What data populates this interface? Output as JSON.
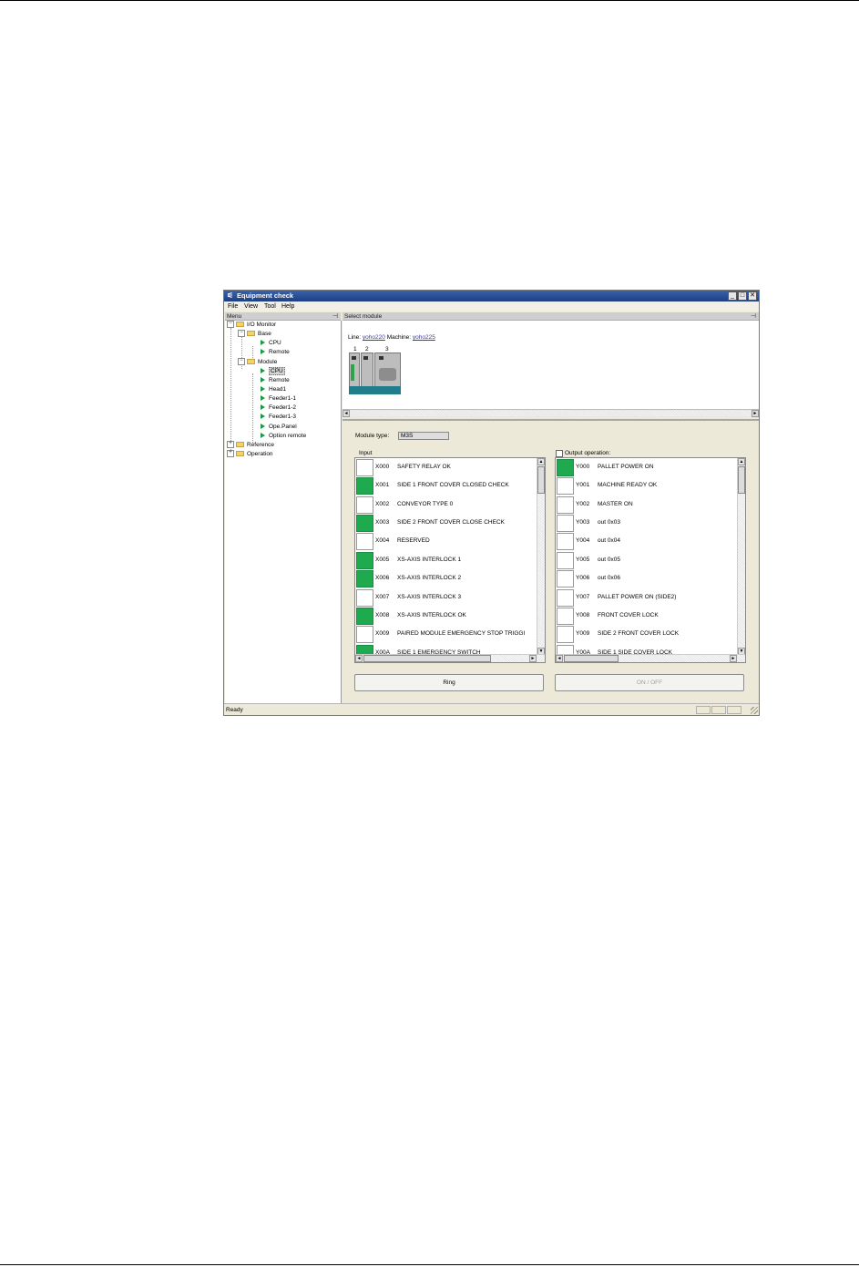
{
  "window": {
    "title": "Equipment check",
    "controls": [
      "_",
      "□",
      "✕"
    ]
  },
  "menubar": [
    "File",
    "View",
    "Tool",
    "Help"
  ],
  "left_pane": {
    "header": "Menu",
    "pin": "⊣",
    "tree": [
      {
        "label": "I/O Monitor",
        "kind": "folder"
      },
      {
        "label": "Base",
        "kind": "folder"
      },
      {
        "label": "CPU",
        "kind": "leaf"
      },
      {
        "label": "Remote",
        "kind": "leaf"
      },
      {
        "label": "Module",
        "kind": "folder"
      },
      {
        "label": "CPU",
        "kind": "leaf",
        "selected": true
      },
      {
        "label": "Remote",
        "kind": "leaf"
      },
      {
        "label": "Head1",
        "kind": "leaf"
      },
      {
        "label": "Feeder1-1",
        "kind": "leaf"
      },
      {
        "label": "Feeder1-2",
        "kind": "leaf"
      },
      {
        "label": "Feeder1-3",
        "kind": "leaf"
      },
      {
        "label": "Ope.Panel",
        "kind": "leaf"
      },
      {
        "label": "Option remote",
        "kind": "leaf"
      },
      {
        "label": "Reference",
        "kind": "folder"
      },
      {
        "label": "Operation",
        "kind": "folder"
      }
    ]
  },
  "select_module": {
    "header": "Select module",
    "pin": "⊣",
    "line_label": "Line:",
    "line_value": "yoho220",
    "machine_label": "Machine:",
    "machine_value": "yoho225",
    "slots": [
      "1",
      "2",
      "3"
    ],
    "scroll_left": "◄",
    "scroll_right": "►"
  },
  "io": {
    "module_type_label": "Module type:",
    "module_type_value": "M3S",
    "input_label": "Input",
    "output_label": "Output operation:",
    "inputs": [
      {
        "addr": "X000",
        "name": "SAFETY RELAY OK",
        "on": false
      },
      {
        "addr": "X001",
        "name": "SIDE 1 FRONT COVER CLOSED CHECK",
        "on": true
      },
      {
        "addr": "X002",
        "name": "CONVEYOR TYPE 0",
        "on": false
      },
      {
        "addr": "X003",
        "name": "SIDE 2 FRONT COVER CLOSE CHECK",
        "on": true
      },
      {
        "addr": "X004",
        "name": "RESERVED",
        "on": false
      },
      {
        "addr": "X005",
        "name": "XS-AXIS INTERLOCK 1",
        "on": true
      },
      {
        "addr": "X006",
        "name": "XS-AXIS INTERLOCK 2",
        "on": true
      },
      {
        "addr": "X007",
        "name": "XS-AXIS INTERLOCK 3",
        "on": false
      },
      {
        "addr": "X008",
        "name": "XS-AXIS INTERLOCK OK",
        "on": true
      },
      {
        "addr": "X009",
        "name": "PAIRED MODULE EMERGENCY STOP TRIGGI",
        "on": false
      },
      {
        "addr": "X00A",
        "name": "SIDE 1 EMERGENCY SWITCH",
        "on": true
      }
    ],
    "outputs": [
      {
        "addr": "Y000",
        "name": "PALLET POWER ON",
        "on": true
      },
      {
        "addr": "Y001",
        "name": "MACHINE READY OK",
        "on": false
      },
      {
        "addr": "Y002",
        "name": "MASTER ON",
        "on": false
      },
      {
        "addr": "Y003",
        "name": "out 0x03",
        "on": false
      },
      {
        "addr": "Y004",
        "name": "out 0x04",
        "on": false
      },
      {
        "addr": "Y005",
        "name": "out 0x05",
        "on": false
      },
      {
        "addr": "Y006",
        "name": "out 0x06",
        "on": false
      },
      {
        "addr": "Y007",
        "name": "PALLET POWER ON (SIDE2)",
        "on": false
      },
      {
        "addr": "Y008",
        "name": "FRONT COVER LOCK",
        "on": false
      },
      {
        "addr": "Y009",
        "name": "SIDE 2 FRONT COVER LOCK",
        "on": false
      },
      {
        "addr": "Y00A",
        "name": "SIDE 1 SIDE COVER LOCK",
        "on": false
      }
    ],
    "ring_button": "Ring",
    "onoff_button": "ON / OFF",
    "scroll_up": "▲",
    "scroll_down": "▼",
    "scroll_left": "◄",
    "scroll_right": "►"
  },
  "statusbar": {
    "text": "Ready"
  },
  "colors": {
    "indicator_on": "#1faa4f",
    "titlebar": "#1c3e86"
  }
}
